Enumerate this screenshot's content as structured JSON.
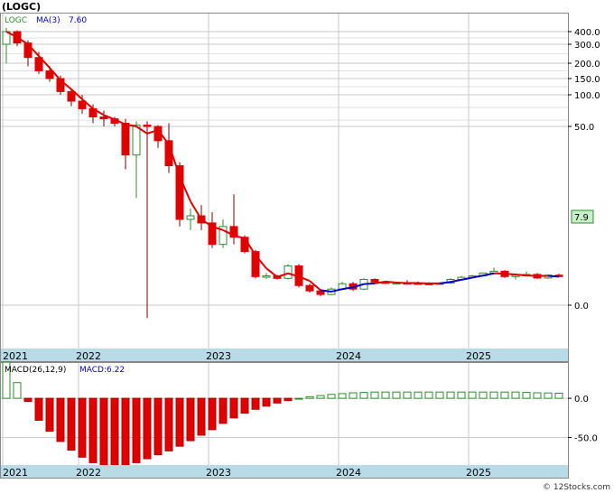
{
  "title": "(LOGC)",
  "watermark": "© 12Stocks.com",
  "colors": {
    "up": "#2e8b2e",
    "down": "#e00000",
    "ma_down": "#e00000",
    "ma_up": "#0000cc",
    "price_badge_fill": "#c8f0c8",
    "date_strip": "#b9dbe8",
    "grid": "#c8c8c8",
    "macd_up_fill": "#ffffff",
    "macd_up_stroke": "#2e8b2e",
    "macd_down_fill": "#e00000"
  },
  "chart_data": [
    {
      "type": "candlestick",
      "name": "price",
      "legend": {
        "ticker": "LOGC",
        "ma_label": "MA(3)",
        "ma_value": "7.60"
      },
      "current_price": "7.9",
      "y_scale": "custom-compressed",
      "y_ticks": [
        {
          "label": "400.0",
          "value": 400
        },
        {
          "label": "300.0",
          "value": 300
        },
        {
          "label": "200.0",
          "value": 200
        },
        {
          "label": "150.0",
          "value": 150
        },
        {
          "label": "100.0",
          "value": 100
        },
        {
          "label": "50.0",
          "value": 50
        },
        {
          "label": "0.0",
          "value": 0
        }
      ],
      "x_labels": [
        "2021",
        "2022",
        "2023",
        "2024",
        "2025"
      ],
      "grid": true,
      "candles": [
        {
          "o": 300,
          "h": 430,
          "l": 200,
          "c": 400
        },
        {
          "o": 400,
          "h": 410,
          "l": 290,
          "c": 310
        },
        {
          "o": 310,
          "h": 330,
          "l": 190,
          "c": 230
        },
        {
          "o": 230,
          "h": 260,
          "l": 165,
          "c": 175
        },
        {
          "o": 175,
          "h": 190,
          "l": 140,
          "c": 150
        },
        {
          "o": 150,
          "h": 160,
          "l": 100,
          "c": 110
        },
        {
          "o": 110,
          "h": 120,
          "l": 82,
          "c": 90
        },
        {
          "o": 90,
          "h": 100,
          "l": 70,
          "c": 78
        },
        {
          "o": 78,
          "h": 85,
          "l": 55,
          "c": 65
        },
        {
          "o": 65,
          "h": 75,
          "l": 50,
          "c": 62
        },
        {
          "o": 62,
          "h": 65,
          "l": 50,
          "c": 55
        },
        {
          "o": 55,
          "h": 62,
          "l": 38,
          "c": 42
        },
        {
          "o": 42,
          "h": 58,
          "l": 30,
          "c": 52
        },
        {
          "o": 52,
          "h": 58,
          "l": -6,
          "c": 50
        },
        {
          "o": 50,
          "h": 52,
          "l": 44,
          "c": 46
        },
        {
          "o": 46,
          "h": 55,
          "l": 37,
          "c": 39
        },
        {
          "o": 39,
          "h": 40,
          "l": 22,
          "c": 24
        },
        {
          "o": 24,
          "h": 27,
          "l": 21,
          "c": 25
        },
        {
          "o": 25,
          "h": 28,
          "l": 21,
          "c": 23
        },
        {
          "o": 23,
          "h": 26,
          "l": 16,
          "c": 17
        },
        {
          "o": 17,
          "h": 24,
          "l": 16,
          "c": 22
        },
        {
          "o": 22,
          "h": 31,
          "l": 17,
          "c": 19
        },
        {
          "o": 19,
          "h": 19.5,
          "l": 14.5,
          "c": 15
        },
        {
          "o": 15,
          "h": 15.5,
          "l": 7.5,
          "c": 8
        },
        {
          "o": 8,
          "h": 9,
          "l": 7.4,
          "c": 8.2
        },
        {
          "o": 8.2,
          "h": 8.5,
          "l": 7.2,
          "c": 7.5
        },
        {
          "o": 7.5,
          "h": 11.5,
          "l": 7.2,
          "c": 11
        },
        {
          "o": 11,
          "h": 11.5,
          "l": 5,
          "c": 5.5
        },
        {
          "o": 5.5,
          "h": 6,
          "l": 3.5,
          "c": 4
        },
        {
          "o": 4,
          "h": 4.5,
          "l": 2.5,
          "c": 3
        },
        {
          "o": 3,
          "h": 5,
          "l": 2.8,
          "c": 4.5
        },
        {
          "o": 4.5,
          "h": 6.5,
          "l": 4.2,
          "c": 6
        },
        {
          "o": 6,
          "h": 6.5,
          "l": 4,
          "c": 4.5
        },
        {
          "o": 4.5,
          "h": 7.5,
          "l": 4.2,
          "c": 7.2
        },
        {
          "o": 7.2,
          "h": 7.5,
          "l": 6.2,
          "c": 6.5
        },
        {
          "o": 6.5,
          "h": 6.8,
          "l": 5.9,
          "c": 6.1
        },
        {
          "o": 6.1,
          "h": 6.5,
          "l": 5.9,
          "c": 6.3
        },
        {
          "o": 6.3,
          "h": 7,
          "l": 6.1,
          "c": 6.2
        },
        {
          "o": 6.2,
          "h": 6.6,
          "l": 5.9,
          "c": 6.1
        },
        {
          "o": 6.1,
          "h": 6.4,
          "l": 5.8,
          "c": 6
        },
        {
          "o": 6,
          "h": 6.4,
          "l": 5.8,
          "c": 6.2
        },
        {
          "o": 6.2,
          "h": 7.6,
          "l": 6,
          "c": 7.2
        },
        {
          "o": 7.2,
          "h": 8.2,
          "l": 7,
          "c": 7.8
        },
        {
          "o": 7.8,
          "h": 8.5,
          "l": 7.5,
          "c": 8.2
        },
        {
          "o": 8.2,
          "h": 9.2,
          "l": 8,
          "c": 9
        },
        {
          "o": 9,
          "h": 10.5,
          "l": 8.6,
          "c": 9.5
        },
        {
          "o": 9.5,
          "h": 9.8,
          "l": 7.6,
          "c": 8
        },
        {
          "o": 8,
          "h": 8.8,
          "l": 7.2,
          "c": 8.4
        },
        {
          "o": 8.4,
          "h": 9.4,
          "l": 8,
          "c": 8.6
        },
        {
          "o": 8.6,
          "h": 9,
          "l": 7.4,
          "c": 7.6
        },
        {
          "o": 7.6,
          "h": 8.6,
          "l": 7.4,
          "c": 8.4
        },
        {
          "o": 8.4,
          "h": 8.8,
          "l": 7.8,
          "c": 8
        }
      ],
      "moving_average": [
        {
          "v": 400,
          "t": "down"
        },
        {
          "v": 355,
          "t": "down"
        },
        {
          "v": 300,
          "t": "down"
        },
        {
          "v": 238,
          "t": "down"
        },
        {
          "v": 185,
          "t": "down"
        },
        {
          "v": 145,
          "t": "down"
        },
        {
          "v": 117,
          "t": "down"
        },
        {
          "v": 93,
          "t": "down"
        },
        {
          "v": 78,
          "t": "down"
        },
        {
          "v": 68,
          "t": "down"
        },
        {
          "v": 61,
          "t": "down"
        },
        {
          "v": 53,
          "t": "down"
        },
        {
          "v": 50,
          "t": "down"
        },
        {
          "v": 48,
          "t": "down"
        },
        {
          "v": 49,
          "t": "down"
        },
        {
          "v": 45,
          "t": "down"
        },
        {
          "v": 36,
          "t": "down"
        },
        {
          "v": 29,
          "t": "down"
        },
        {
          "v": 24,
          "t": "down"
        },
        {
          "v": 22,
          "t": "down"
        },
        {
          "v": 21,
          "t": "down"
        },
        {
          "v": 19.5,
          "t": "down"
        },
        {
          "v": 18.7,
          "t": "down"
        },
        {
          "v": 14,
          "t": "down"
        },
        {
          "v": 10.3,
          "t": "down"
        },
        {
          "v": 7.9,
          "t": "down"
        },
        {
          "v": 8.9,
          "t": "down"
        },
        {
          "v": 8,
          "t": "down"
        },
        {
          "v": 6.8,
          "t": "down"
        },
        {
          "v": 4.2,
          "t": "down"
        },
        {
          "v": 3.8,
          "t": "up"
        },
        {
          "v": 4.5,
          "t": "up"
        },
        {
          "v": 5,
          "t": "up"
        },
        {
          "v": 5.9,
          "t": "up"
        },
        {
          "v": 6.1,
          "t": "up"
        },
        {
          "v": 6.6,
          "t": "down"
        },
        {
          "v": 6.3,
          "t": "down"
        },
        {
          "v": 6.2,
          "t": "down"
        },
        {
          "v": 6.2,
          "t": "down"
        },
        {
          "v": 6.1,
          "t": "down"
        },
        {
          "v": 6.1,
          "t": "down"
        },
        {
          "v": 6.5,
          "t": "up"
        },
        {
          "v": 7.1,
          "t": "up"
        },
        {
          "v": 7.7,
          "t": "up"
        },
        {
          "v": 8.3,
          "t": "up"
        },
        {
          "v": 8.9,
          "t": "up"
        },
        {
          "v": 8.8,
          "t": "down"
        },
        {
          "v": 8.6,
          "t": "down"
        },
        {
          "v": 8.3,
          "t": "down"
        },
        {
          "v": 8.2,
          "t": "down"
        },
        {
          "v": 8.2,
          "t": "down"
        },
        {
          "v": 8,
          "t": "up"
        }
      ]
    },
    {
      "type": "bar",
      "name": "macd",
      "legend": {
        "label": "MACD(26,12,9)",
        "value_label": "MACD:6.22"
      },
      "y_ticks": [
        {
          "label": "0.0",
          "value": 0
        },
        {
          "label": "-50.0",
          "value": -50
        }
      ],
      "ylim": [
        -85,
        45
      ],
      "x_labels": [
        "2021",
        "2022",
        "2023",
        "2024",
        "2025"
      ],
      "values": [
        46,
        20,
        -4,
        -28,
        -42,
        -55,
        -66,
        -75,
        -82,
        -86,
        -88,
        -86,
        -82,
        -77,
        -72,
        -67,
        -61,
        -54,
        -47,
        -40,
        -32,
        -25,
        -19,
        -14,
        -10,
        -6,
        -3,
        0,
        2,
        3.5,
        5,
        6,
        7,
        7.5,
        8,
        8,
        8,
        8,
        8,
        8,
        8,
        8,
        8,
        8,
        8,
        8,
        8,
        8,
        7.5,
        7,
        6.8,
        6.5
      ]
    }
  ]
}
